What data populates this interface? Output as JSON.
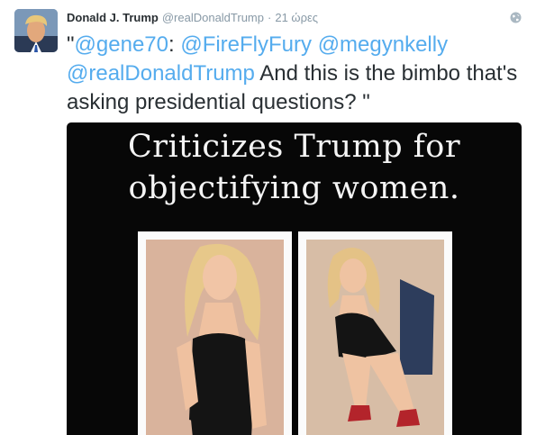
{
  "tweet": {
    "author_name": "Donald J. Trump",
    "author_handle": "@realDonaldTrump",
    "separator": "·",
    "timestamp": "21 ώρες",
    "text_parts": [
      {
        "text": "\"",
        "type": "plain"
      },
      {
        "text": "@gene70",
        "type": "mention"
      },
      {
        "text": ": ",
        "type": "plain"
      },
      {
        "text": "@FireFlyFury",
        "type": "mention"
      },
      {
        "text": " ",
        "type": "plain"
      },
      {
        "text": "@megynkelly",
        "type": "mention"
      },
      {
        "text": " ",
        "type": "plain"
      },
      {
        "text": "@realDonaldTrump",
        "type": "mention"
      },
      {
        "text": " And this is the bimbo that's asking presidential questions? \"",
        "type": "plain"
      }
    ],
    "icons": {
      "avatar": "author-avatar",
      "privacy": "globe-icon"
    },
    "colors": {
      "link": "#55acee",
      "text": "#292f33",
      "muted": "#8899a6"
    }
  },
  "media": {
    "caption_line1": "Criticizes Trump for",
    "caption_line2": "objectifying women.",
    "photos": [
      "photo-left",
      "photo-right"
    ]
  }
}
